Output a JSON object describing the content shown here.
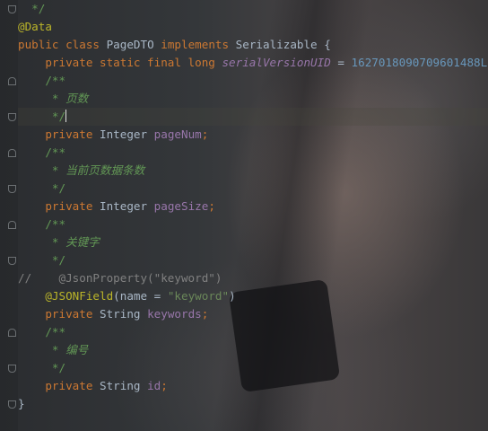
{
  "editor": {
    "lines": [
      {
        "tokens": [
          {
            "t": "  */",
            "c": "doc"
          }
        ]
      },
      {
        "tokens": [
          {
            "t": "@Data",
            "c": "ann"
          }
        ]
      },
      {
        "tokens": [
          {
            "t": "public class ",
            "c": "kw"
          },
          {
            "t": "PageDTO ",
            "c": "plain"
          },
          {
            "t": "implements ",
            "c": "kw"
          },
          {
            "t": "Serializable {",
            "c": "plain"
          }
        ]
      },
      {
        "tokens": [
          {
            "t": "    private static final long ",
            "c": "kw"
          },
          {
            "t": "serialVersionUID",
            "c": "const"
          },
          {
            "t": " = ",
            "c": "plain"
          },
          {
            "t": "1627018090709601488L",
            "c": "num"
          },
          {
            "t": ";",
            "c": "kw"
          }
        ]
      },
      {
        "tokens": [
          {
            "t": "    /**",
            "c": "doc"
          }
        ]
      },
      {
        "tokens": [
          {
            "t": "     * 页数",
            "c": "doc-i"
          }
        ]
      },
      {
        "tokens": [
          {
            "t": "     */",
            "c": "doc"
          }
        ],
        "current": true
      },
      {
        "tokens": [
          {
            "t": "    private ",
            "c": "kw"
          },
          {
            "t": "Integer ",
            "c": "plain"
          },
          {
            "t": "pageNum",
            "c": "field"
          },
          {
            "t": ";",
            "c": "kw"
          }
        ]
      },
      {
        "tokens": [
          {
            "t": "    /**",
            "c": "doc"
          }
        ]
      },
      {
        "tokens": [
          {
            "t": "     * 当前页数据条数",
            "c": "doc-i"
          }
        ]
      },
      {
        "tokens": [
          {
            "t": "     */",
            "c": "doc"
          }
        ]
      },
      {
        "tokens": [
          {
            "t": "    private ",
            "c": "kw"
          },
          {
            "t": "Integer ",
            "c": "plain"
          },
          {
            "t": "pageSize",
            "c": "field"
          },
          {
            "t": ";",
            "c": "kw"
          }
        ]
      },
      {
        "tokens": [
          {
            "t": "    /**",
            "c": "doc"
          }
        ]
      },
      {
        "tokens": [
          {
            "t": "     * 关键字",
            "c": "doc-i"
          }
        ]
      },
      {
        "tokens": [
          {
            "t": "     */",
            "c": "doc"
          }
        ]
      },
      {
        "tokens": [
          {
            "t": "//    @JsonProperty(\"keyword\")",
            "c": "cmt"
          }
        ]
      },
      {
        "tokens": [
          {
            "t": "    @JSONField",
            "c": "ann"
          },
          {
            "t": "(name = ",
            "c": "plain"
          },
          {
            "t": "\"keyword\"",
            "c": "str"
          },
          {
            "t": ")",
            "c": "plain"
          }
        ]
      },
      {
        "tokens": [
          {
            "t": "    private ",
            "c": "kw"
          },
          {
            "t": "String ",
            "c": "plain"
          },
          {
            "t": "keywords",
            "c": "field"
          },
          {
            "t": ";",
            "c": "kw"
          }
        ]
      },
      {
        "tokens": [
          {
            "t": "    /**",
            "c": "doc"
          }
        ]
      },
      {
        "tokens": [
          {
            "t": "     * 编号",
            "c": "doc-i"
          }
        ]
      },
      {
        "tokens": [
          {
            "t": "     */",
            "c": "doc"
          }
        ]
      },
      {
        "tokens": [
          {
            "t": "    private ",
            "c": "kw"
          },
          {
            "t": "String ",
            "c": "plain"
          },
          {
            "t": "id",
            "c": "field"
          },
          {
            "t": ";",
            "c": "kw"
          }
        ]
      },
      {
        "tokens": [
          {
            "t": "}",
            "c": "plain"
          }
        ]
      }
    ]
  },
  "colors": {
    "keyword": "#cc7832",
    "annotation": "#bbb529",
    "doc_comment": "#629755",
    "number": "#6897bb",
    "string": "#6a8759",
    "field": "#9876aa",
    "comment": "#808080",
    "text": "#a9b7c6"
  }
}
